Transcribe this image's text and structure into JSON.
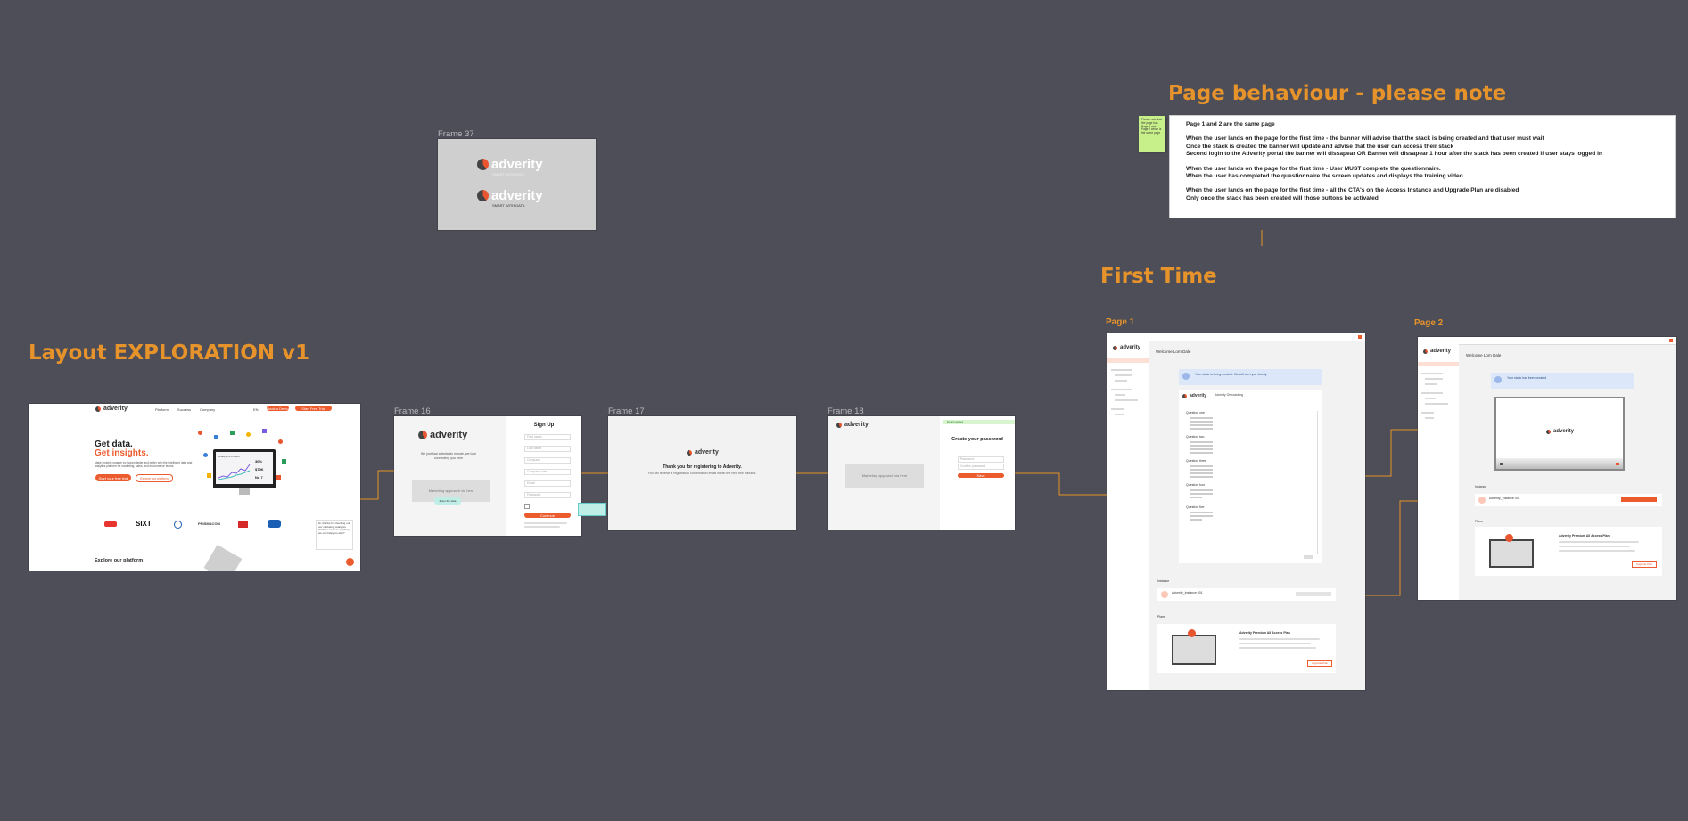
{
  "canvas": {
    "headings": {
      "layout_exploration": "Layout EXPLORATION v1",
      "page_behaviour": "Page behaviour - please note",
      "first_time": "First Time"
    },
    "frame_labels": {
      "frame37": "Frame 37",
      "frame16": "Frame 16",
      "frame17": "Frame 17",
      "frame18": "Frame 18",
      "page1": "Page 1",
      "page2": "Page 2"
    }
  },
  "note": {
    "lines": [
      "Page 1 and 2 are the same page",
      "",
      "When the user lands on the page for the first time - the banner will advise that the stack is being created and that user must wait",
      "Once the stack is created the banner will update and advise that the user can access their stack",
      "Second login to the Adverity portal the banner will dissapear OR Banner will dissapear 1 hour after the stack has been created if user stays logged in",
      "",
      "When the user lands on the page for the first time - User MUST complete the questionnaire.",
      "When the user has completed the questionnaire the screen updates and displays the training video",
      "",
      "When the user lands on the page for the first time - all the CTA's on the Access Instance and Upgrade Plan are disabled",
      "Only once the stack has been created will those buttons be activated"
    ]
  },
  "brand": {
    "name": "adverity",
    "tagline": "SMART WITH DATA",
    "accent": "#ec5b2e",
    "heading_color": "#e7932b",
    "canvas_bg": "#4d4e57"
  },
  "landing": {
    "nav": [
      "Platform",
      "Success",
      "Company"
    ],
    "nav_right": [
      "EN",
      "Book a Demo",
      "Start Free Trial"
    ],
    "headline1": "Get data.",
    "headline2": "Get insights.",
    "body": "Make insights smarter by launch faster and better with the intelligent data and analytics platform for marketing, sales, and eCommerce teams.",
    "cta_primary": "Start your free trial",
    "cta_secondary": "Explore our platform",
    "monitor": {
      "chart_title": "Analyze & Predict",
      "kpi1": "30%",
      "kpi2": "$70K",
      "kpi3": "No 7"
    },
    "logos": [
      "SIXT",
      "PRISMACOM"
    ],
    "explore": "Explore our platform",
    "chat": "Hi, thanks for checking out our marketing analytics platform. Is there anything we can help you with?"
  },
  "signup": {
    "marketing_text": "We just had a fantastic minute, we love connecting you here",
    "placeholder": "Marketing approach via here",
    "title": "Sign Up",
    "fields": [
      "First name",
      "Last name",
      "Company",
      "Company size",
      "Email",
      "Password"
    ],
    "button": "Continue",
    "tooltip": "Enter the data"
  },
  "thanks": {
    "title": "Thank you for registering to Adverity.",
    "body": "You will receive a registration confirmation email within the next few minutes."
  },
  "password": {
    "placeholder": "Marketing approach via here",
    "title": "Create your password",
    "fields": [
      "Password",
      "Confirm password"
    ],
    "button": "Save",
    "toast": "Email verified"
  },
  "page1": {
    "welcome": "Welcome Lorn Dale",
    "banner": "Your stack is being created. We will alert you shortly.",
    "survey_title": "Adverity Onboarding",
    "sections": [
      "Question one",
      "Question two",
      "Question three",
      "Question four",
      "Question five"
    ],
    "instance_section": "Instance",
    "instance_name": "Adverity_Instance 001",
    "plans_section": "Plans",
    "plan_title": "Adverity Premium All Access Plan",
    "plan_cta": "Upgrade Plan"
  },
  "page2": {
    "welcome": "Welcome Lorn Dale",
    "banner": "Your stack has been created",
    "instance_section": "Instance",
    "instance_name": "Adverity_Instance 001",
    "plans_section": "Plans",
    "plan_title": "Adverity Premium All Access Plan",
    "plan_cta": "Upgrade Plan"
  },
  "sticky_text": "Please note that the page has Page 1 and Page 2 which is the same page"
}
